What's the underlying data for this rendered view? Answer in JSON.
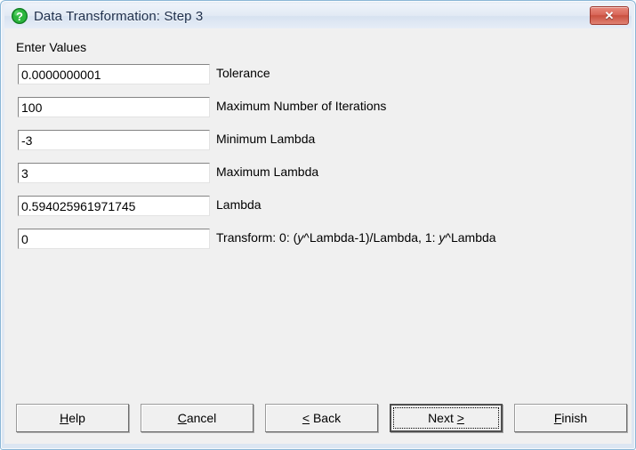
{
  "window": {
    "title": "Data Transformation: Step 3",
    "title_icon": "question-mark-icon",
    "close_label": "✕"
  },
  "form": {
    "section_label": "Enter Values",
    "fields": [
      {
        "value": "0.0000000001",
        "label": "Tolerance",
        "name": "tolerance"
      },
      {
        "value": "100",
        "label": "Maximum Number of Iterations",
        "name": "max-iterations"
      },
      {
        "value": "-3",
        "label": "Minimum Lambda",
        "name": "minimum-lambda"
      },
      {
        "value": "3",
        "label": "Maximum Lambda",
        "name": "maximum-lambda"
      },
      {
        "value": "0.594025961971745",
        "label": "Lambda",
        "name": "lambda"
      },
      {
        "value": "0",
        "label": "Transform: 0: (y^Lambda-1)/Lambda, 1: y^Lambda",
        "name": "transform"
      }
    ]
  },
  "buttons": [
    {
      "label": "Help",
      "accel": "H",
      "default": false,
      "name": "help-button"
    },
    {
      "label": "Cancel",
      "accel": "C",
      "default": false,
      "name": "cancel-button"
    },
    {
      "label": "< Back",
      "accel": "<",
      "default": false,
      "name": "back-button"
    },
    {
      "label": "Next >",
      "accel": ">",
      "default": true,
      "name": "next-button"
    },
    {
      "label": "Finish",
      "accel": "F",
      "default": false,
      "name": "finish-button"
    }
  ],
  "colors": {
    "title_text": "#1c2d4a",
    "client_bg": "#f0f0f0",
    "frame_border": "#8ab6d6",
    "close_button": "#d9685a",
    "icon_green": "#21a436"
  }
}
